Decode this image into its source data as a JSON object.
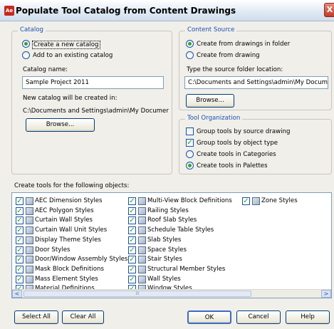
{
  "window": {
    "title": "Populate Tool Catalog from Content Drawings",
    "close_glyph": "X",
    "app_icon_text": "Ae"
  },
  "catalog": {
    "group_title": "Catalog",
    "create_new_label": "Create a new catalog",
    "add_existing_label": "Add to an existing catalog",
    "selected": "create_new",
    "name_label": "Catalog name:",
    "name_value": "Sample Project 2011",
    "created_in_label": "New catalog will be created in:",
    "created_in_path": "C:\\Documents and Settings\\admin\\My Documer",
    "browse_label": "Browse..."
  },
  "content_source": {
    "group_title": "Content Source",
    "from_folder_label": "Create from drawings in folder",
    "from_drawing_label": "Create from drawing",
    "selected": "from_folder",
    "folder_label": "Type the source folder location:",
    "folder_value": "C:\\Documents and Settings\\admin\\My Document:",
    "browse_label": "Browse..."
  },
  "tool_organization": {
    "group_title": "Tool Organization",
    "group_by_source_label": "Group tools by source drawing",
    "group_by_source_checked": false,
    "group_by_type_label": "Group tools by object type",
    "group_by_type_checked": true,
    "in_categories_label": "Create tools in Categories",
    "in_palettes_label": "Create tools in Palettes",
    "selected": "palettes"
  },
  "objects_label": "Create tools for the following objects:",
  "objects": [
    {
      "label": "AEC Dimension Styles",
      "checked": true,
      "icon": "dimension-icon"
    },
    {
      "label": "AEC Polygon Styles",
      "checked": true,
      "icon": "polygon-icon"
    },
    {
      "label": "Curtain Wall Styles",
      "checked": true,
      "icon": "curtain-wall-icon"
    },
    {
      "label": "Curtain Wall Unit Styles",
      "checked": true,
      "icon": "curtain-wall-unit-icon"
    },
    {
      "label": "Display Theme Styles",
      "checked": true,
      "icon": "display-theme-icon"
    },
    {
      "label": "Door Styles",
      "checked": true,
      "icon": "door-icon"
    },
    {
      "label": "Door/Window Assembly Styles",
      "checked": true,
      "icon": "door-window-assembly-icon"
    },
    {
      "label": "Mask Block Definitions",
      "checked": true,
      "icon": "mask-block-icon"
    },
    {
      "label": "Mass Element Styles",
      "checked": true,
      "icon": "mass-element-icon"
    },
    {
      "label": "Material Definitions",
      "checked": true,
      "icon": "material-icon"
    },
    {
      "label": "Multi-View Block Definitions",
      "checked": true,
      "icon": "multi-view-block-icon"
    },
    {
      "label": "Railing Styles",
      "checked": true,
      "icon": "railing-icon"
    },
    {
      "label": "Roof Slab Styles",
      "checked": true,
      "icon": "roof-slab-icon"
    },
    {
      "label": "Schedule Table Styles",
      "checked": true,
      "icon": "schedule-table-icon"
    },
    {
      "label": "Slab Styles",
      "checked": true,
      "icon": "slab-icon"
    },
    {
      "label": "Space Styles",
      "checked": true,
      "icon": "space-icon"
    },
    {
      "label": "Stair Styles",
      "checked": true,
      "icon": "stair-icon"
    },
    {
      "label": "Structural Member Styles",
      "checked": true,
      "icon": "structural-member-icon"
    },
    {
      "label": "Wall Styles",
      "checked": true,
      "icon": "wall-icon"
    },
    {
      "label": "Window Styles",
      "checked": true,
      "icon": "window-icon"
    },
    {
      "label": "Zone Styles",
      "checked": true,
      "icon": "zone-icon"
    }
  ],
  "buttons": {
    "select_all": "Select All",
    "clear_all": "Clear All",
    "ok": "OK",
    "cancel": "Cancel",
    "help": "Help"
  },
  "scroll": {
    "left_glyph": "<",
    "right_glyph": ">",
    "thumb_grip": "III"
  },
  "check_glyph": "✓"
}
